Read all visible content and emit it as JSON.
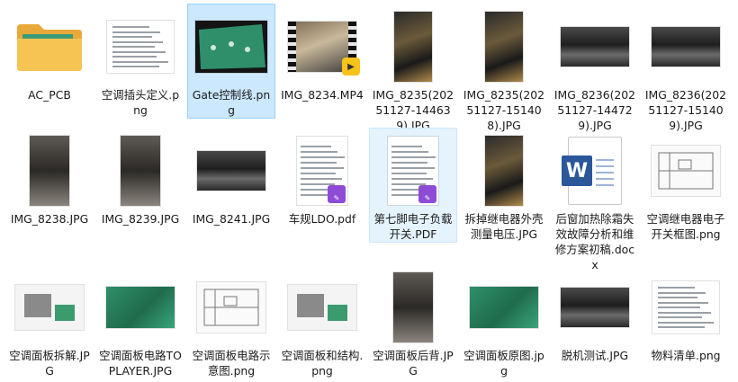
{
  "files": [
    {
      "id": "ac-pcb",
      "label": "AC_PCB",
      "kind": "folder",
      "thumb": "folder"
    },
    {
      "id": "plug-def",
      "label": "空调插头定义.png",
      "kind": "image",
      "thumb": "doc"
    },
    {
      "id": "gate-wire",
      "label": "Gate控制线.png",
      "kind": "image",
      "thumb": "pcb-black",
      "state": "selected"
    },
    {
      "id": "img-8234",
      "label": "IMG_8234.MP4",
      "kind": "video",
      "thumb": "video",
      "badge": "play-icon"
    },
    {
      "id": "img-8235a",
      "label": "IMG_8235(20251127-144639).JPG",
      "kind": "image",
      "thumb": "wire"
    },
    {
      "id": "img-8235b",
      "label": "IMG_8235(20251127-151408).JPG",
      "kind": "image",
      "thumb": "wire"
    },
    {
      "id": "img-8236a",
      "label": "IMG_8236(20251127-144729).JPG",
      "kind": "image",
      "thumb": "car"
    },
    {
      "id": "img-8236b",
      "label": "IMG_8236(20251127-151409).JPG",
      "kind": "image",
      "thumb": "car"
    },
    {
      "id": "img-8238",
      "label": "IMG_8238.JPG",
      "kind": "image",
      "thumb": "car2"
    },
    {
      "id": "img-8239",
      "label": "IMG_8239.JPG",
      "kind": "image",
      "thumb": "car2"
    },
    {
      "id": "img-8241",
      "label": "IMG_8241.JPG",
      "kind": "image",
      "thumb": "car"
    },
    {
      "id": "ldo-pdf",
      "label": "车规LDO.pdf",
      "kind": "pdf",
      "thumb": "pdf",
      "badge": "pdf-editor-icon"
    },
    {
      "id": "pin7-pdf",
      "label": "第七脚电子负载开关.PDF",
      "kind": "pdf",
      "thumb": "pdf",
      "badge": "pdf-editor-icon",
      "state": "focused"
    },
    {
      "id": "relay-voltage",
      "label": "拆掉继电器外壳测量电压.JPG",
      "kind": "image",
      "thumb": "wire"
    },
    {
      "id": "defrost-docx",
      "label": "后窗加热除霜失效故障分析和维修方案初稿.docx",
      "kind": "word",
      "thumb": "word"
    },
    {
      "id": "relay-switch",
      "label": "空调继电器电子开关框图.png",
      "kind": "image",
      "thumb": "sketch"
    },
    {
      "id": "panel-teardown",
      "label": "空调面板拆解.JPG",
      "kind": "image",
      "thumb": "white"
    },
    {
      "id": "toplayer",
      "label": "空调面板电路TOPLAYER.JPG",
      "kind": "image",
      "thumb": "pcb-green"
    },
    {
      "id": "panel-circuit",
      "label": "空调面板电路示意图.png",
      "kind": "image",
      "thumb": "sketch"
    },
    {
      "id": "panel-structure",
      "label": "空调面板和结构.png",
      "kind": "image",
      "thumb": "white"
    },
    {
      "id": "panel-back",
      "label": "空调面板后背.JPG",
      "kind": "image",
      "thumb": "car2"
    },
    {
      "id": "panel-orig",
      "label": "空调面板原图.jpg",
      "kind": "image",
      "thumb": "pcb-green"
    },
    {
      "id": "offline-test",
      "label": "脱机测试.JPG",
      "kind": "image",
      "thumb": "car"
    },
    {
      "id": "bom",
      "label": "物料清单.png",
      "kind": "image",
      "thumb": "doc"
    }
  ],
  "colors": {
    "selected_bg": "#cce8ff",
    "folder": "#f6c453",
    "word": "#2b579a",
    "pdf_badge": "#8e4bd6",
    "play_badge": "#f7c21a"
  }
}
